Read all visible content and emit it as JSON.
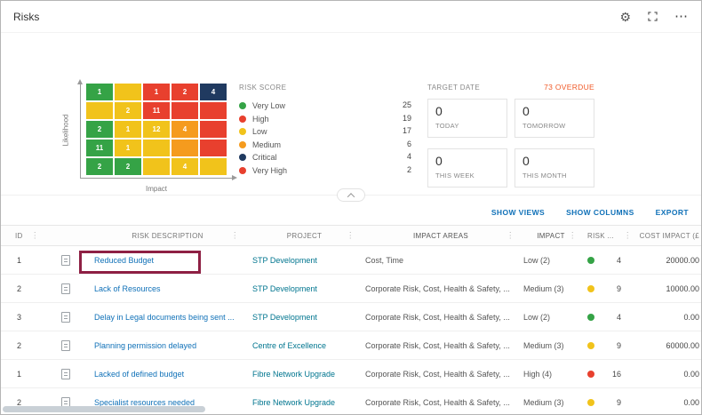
{
  "colors": {
    "green": "#35a346",
    "yellow": "#f1c31b",
    "orange": "#f59b1e",
    "red": "#e8402e",
    "navy": "#203a60",
    "overdue_orange": "#f05a28",
    "link_blue": "#1071b8",
    "description_blue": "#1071b8",
    "project_teal": "#00758f",
    "annotation_maroon": "#8e2044"
  },
  "header": {
    "title": "Risks",
    "icons": [
      {
        "name": "settings-icon",
        "glyph": "⚙"
      },
      {
        "name": "fit-screen-icon",
        "glyph": "⛶"
      },
      {
        "name": "more-icon",
        "glyph": "⋯"
      }
    ]
  },
  "dashboard": {
    "matrix": {
      "x_label": "Impact",
      "y_label": "Likelihood",
      "rows": [
        [
          {
            "v": "1",
            "c": "green"
          },
          {
            "v": "",
            "c": "yellow"
          },
          {
            "v": "1",
            "c": "red"
          },
          {
            "v": "2",
            "c": "red"
          },
          {
            "v": "4",
            "c": "navy"
          }
        ],
        [
          {
            "v": "",
            "c": "yellow"
          },
          {
            "v": "2",
            "c": "yellow"
          },
          {
            "v": "11",
            "c": "red"
          },
          {
            "v": "",
            "c": "red"
          },
          {
            "v": "",
            "c": "red"
          }
        ],
        [
          {
            "v": "2",
            "c": "green"
          },
          {
            "v": "1",
            "c": "yellow"
          },
          {
            "v": "12",
            "c": "yellow"
          },
          {
            "v": "4",
            "c": "orange"
          },
          {
            "v": "",
            "c": "red"
          }
        ],
        [
          {
            "v": "11",
            "c": "green"
          },
          {
            "v": "1",
            "c": "yellow"
          },
          {
            "v": "",
            "c": "yellow"
          },
          {
            "v": "",
            "c": "orange"
          },
          {
            "v": "",
            "c": "red"
          }
        ],
        [
          {
            "v": "2",
            "c": "green"
          },
          {
            "v": "2",
            "c": "green"
          },
          {
            "v": "",
            "c": "yellow"
          },
          {
            "v": "4",
            "c": "yellow"
          },
          {
            "v": "",
            "c": "yellow"
          }
        ]
      ]
    },
    "legend": {
      "title": "RISK SCORE",
      "items": [
        {
          "label": "Very Low",
          "count": "25",
          "color": "green"
        },
        {
          "label": "High",
          "count": "19",
          "color": "red"
        },
        {
          "label": "Low",
          "count": "17",
          "color": "yellow"
        },
        {
          "label": "Medium",
          "count": "6",
          "color": "orange"
        },
        {
          "label": "Critical",
          "count": "4",
          "color": "navy"
        },
        {
          "label": "Very High",
          "count": "2",
          "color": "red"
        }
      ]
    },
    "target_date": {
      "title": "TARGET DATE",
      "overdue": "73 OVERDUE",
      "boxes": [
        {
          "value": "0",
          "label": "TODAY"
        },
        {
          "value": "0",
          "label": "TOMORROW"
        },
        {
          "value": "0",
          "label": "THIS WEEK"
        },
        {
          "value": "0",
          "label": "THIS MONTH"
        }
      ]
    }
  },
  "toolbar": {
    "links": [
      "SHOW VIEWS",
      "SHOW COLUMNS",
      "EXPORT"
    ]
  },
  "table": {
    "columns": [
      {
        "label": "ID",
        "menu": true
      },
      {
        "label": "",
        "menu": false
      },
      {
        "label": "RISK DESCRIPTION",
        "menu": true
      },
      {
        "label": "PROJECT",
        "menu": true
      },
      {
        "label": "IMPACT AREAS",
        "menu": true
      },
      {
        "label": "IMPACT",
        "menu": true
      },
      {
        "label": "RISK ...",
        "menu": true
      },
      {
        "label": "COST IMPACT (£",
        "menu": false
      }
    ],
    "rows": [
      {
        "id": "1",
        "description": "Reduced Budget",
        "project": "STP Development",
        "impact_areas": "Cost, Time",
        "impact": "Low (2)",
        "score_color": "green",
        "score": "4",
        "cost": "20000.00",
        "highlighted": true
      },
      {
        "id": "2",
        "description": "Lack of Resources",
        "project": "STP Development",
        "impact_areas": "Corporate Risk, Cost, Health & Safety, ...",
        "impact": "Medium (3)",
        "score_color": "yellow",
        "score": "9",
        "cost": "10000.00",
        "highlighted": false
      },
      {
        "id": "3",
        "description": "Delay in Legal documents being sent ...",
        "project": "STP Development",
        "impact_areas": "Corporate Risk, Cost, Health & Safety, ...",
        "impact": "Low (2)",
        "score_color": "green",
        "score": "4",
        "cost": "0.00",
        "highlighted": false
      },
      {
        "id": "2",
        "description": "Planning permission delayed",
        "project": "Centre of Excellence",
        "impact_areas": "Corporate Risk, Cost, Health & Safety, ...",
        "impact": "Medium (3)",
        "score_color": "yellow",
        "score": "9",
        "cost": "60000.00",
        "highlighted": false
      },
      {
        "id": "1",
        "description": "Lacked of defined budget",
        "project": "Fibre Network Upgrade",
        "impact_areas": "Corporate Risk, Cost, Health & Safety, ...",
        "impact": "High (4)",
        "score_color": "red",
        "score": "16",
        "cost": "0.00",
        "highlighted": false
      },
      {
        "id": "2",
        "description": "Specialist resources needed",
        "project": "Fibre Network Upgrade",
        "impact_areas": "Corporate Risk, Cost, Health & Safety, ...",
        "impact": "Medium (3)",
        "score_color": "yellow",
        "score": "9",
        "cost": "0.00",
        "highlighted": false
      }
    ]
  }
}
